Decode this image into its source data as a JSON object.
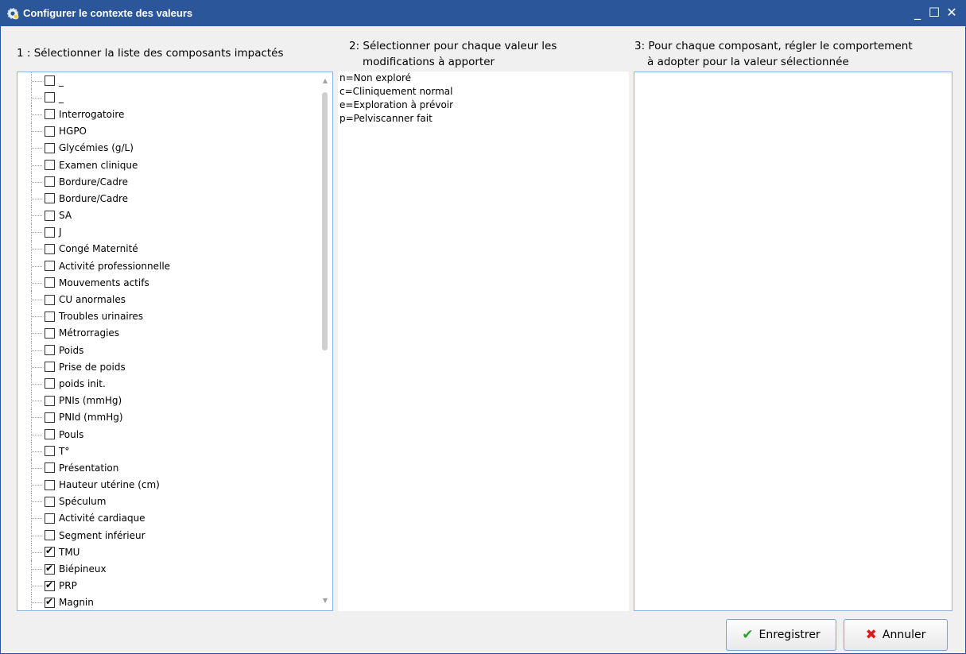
{
  "window": {
    "title": "Configurer le contexte des valeurs",
    "controls": {
      "minimize": "_",
      "maximize": "☐",
      "close": "✕"
    }
  },
  "columns": {
    "col1_title": "1 : Sélectionner la liste des composants impactés",
    "col2_title_line1": "2: Sélectionner pour chaque valeur les",
    "col2_title_line2": "modifications à apporter",
    "col3_title_line1": "3: Pour chaque composant, régler le comportement",
    "col3_title_line2": "à adopter pour la valeur sélectionnée"
  },
  "components": [
    {
      "label": "_",
      "checked": false
    },
    {
      "label": "_",
      "checked": false
    },
    {
      "label": "Interrogatoire",
      "checked": false
    },
    {
      "label": "HGPO",
      "checked": false
    },
    {
      "label": "Glycémies (g/L)",
      "checked": false
    },
    {
      "label": "Examen clinique",
      "checked": false
    },
    {
      "label": "Bordure/Cadre",
      "checked": false
    },
    {
      "label": "Bordure/Cadre",
      "checked": false
    },
    {
      "label": "SA",
      "checked": false
    },
    {
      "label": "J",
      "checked": false
    },
    {
      "label": "Congé Maternité",
      "checked": false
    },
    {
      "label": "Activité professionnelle",
      "checked": false
    },
    {
      "label": "Mouvements actifs",
      "checked": false
    },
    {
      "label": "CU anormales",
      "checked": false
    },
    {
      "label": "Troubles urinaires",
      "checked": false
    },
    {
      "label": "Métrorragies",
      "checked": false
    },
    {
      "label": "Poids",
      "checked": false
    },
    {
      "label": "Prise de poids",
      "checked": false
    },
    {
      "label": "poids init.",
      "checked": false
    },
    {
      "label": "PNIs (mmHg)",
      "checked": false
    },
    {
      "label": "PNId (mmHg)",
      "checked": false
    },
    {
      "label": "Pouls",
      "checked": false
    },
    {
      "label": "T°",
      "checked": false
    },
    {
      "label": "Présentation",
      "checked": false
    },
    {
      "label": "Hauteur utérine (cm)",
      "checked": false
    },
    {
      "label": "Spéculum",
      "checked": false
    },
    {
      "label": "Activité cardiaque",
      "checked": false
    },
    {
      "label": "Segment inférieur",
      "checked": false
    },
    {
      "label": "TMU",
      "checked": true
    },
    {
      "label": "Biépineux",
      "checked": true
    },
    {
      "label": "PRP",
      "checked": true
    },
    {
      "label": "Magnin",
      "checked": true
    }
  ],
  "values_legend": [
    "n=Non exploré",
    "c=Cliniquement normal",
    "e=Exploration à prévoir",
    "p=Pelviscanner fait"
  ],
  "buttons": {
    "save_label": "Enregistrer",
    "cancel_label": "Annuler",
    "save_icon": "check-icon",
    "cancel_icon": "x-icon"
  },
  "colors": {
    "titlebar": "#2b579a",
    "panel_border": "#8fb6e3",
    "save_icon": "#29a32e",
    "cancel_icon": "#d62020"
  }
}
